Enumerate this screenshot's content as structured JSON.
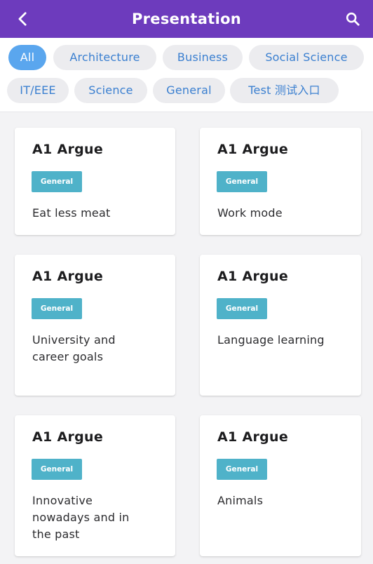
{
  "header": {
    "title": "Presentation",
    "back_icon": "chevron-left-icon",
    "search_icon": "search-icon",
    "background": "#6d3bbd"
  },
  "chips": [
    {
      "label": "All",
      "active": true
    },
    {
      "label": "Architecture",
      "active": false
    },
    {
      "label": "Business",
      "active": false
    },
    {
      "label": "Social Science",
      "active": false
    },
    {
      "label": "IT/EEE",
      "active": false
    },
    {
      "label": "Science",
      "active": false
    },
    {
      "label": "General",
      "active": false
    },
    {
      "label": "Test 测试入口",
      "active": false
    }
  ],
  "cards": [
    {
      "title": "A1 Argue",
      "tag": "General",
      "description": "Eat less meat"
    },
    {
      "title": "A1 Argue",
      "tag": "General",
      "description": "Work mode"
    },
    {
      "title": "A1 Argue",
      "tag": "General",
      "description": "University and career goals"
    },
    {
      "title": "A1 Argue",
      "tag": "General",
      "description": "Language learning"
    },
    {
      "title": "A1 Argue",
      "tag": "General",
      "description": "Innovative nowadays and in the past"
    },
    {
      "title": "A1 Argue",
      "tag": "General",
      "description": "Animals"
    }
  ],
  "colors": {
    "accent": "#6d3bbd",
    "chip_active": "#5aa6ee",
    "chip_text": "#3a7fd0",
    "badge": "#4fb2c9"
  }
}
